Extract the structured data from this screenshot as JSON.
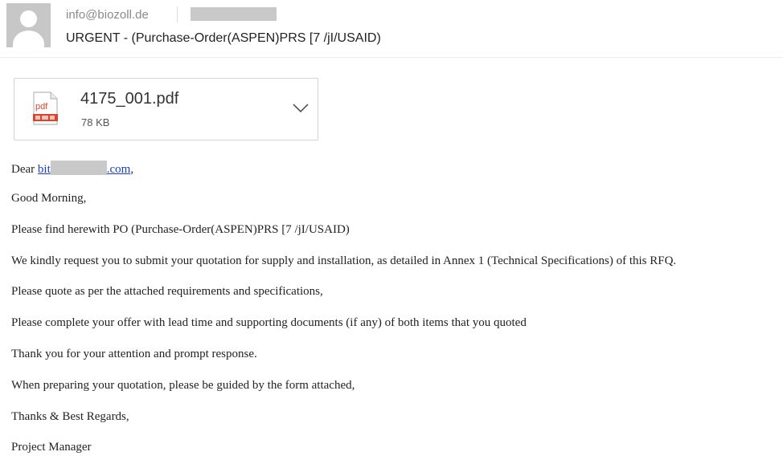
{
  "header": {
    "sender": "info@biozoll.de",
    "subject": "URGENT - (Purchase-Order(ASPEN)PRS [7 /jI/USAID)"
  },
  "attachment": {
    "name": "4175_001.pdf",
    "size": "78 KB",
    "icon_text": "pdf"
  },
  "body": {
    "greeting_prefix": "Dear",
    "recipient_start": "bit",
    "recipient_end": ".com",
    "greeting_suffix": ",",
    "lines": [
      "Good Morning,",
      "Please find herewith PO (Purchase-Order(ASPEN)PRS [7 /jI/USAID)",
      "We kindly request you to submit your quotation for supply and installation, as detailed in Annex 1 (Technical Specifications) of this RFQ.",
      "Please quote as per the attached requirements and specifications,",
      "Please complete your offer with lead time and supporting documents (if any) of both items that you quoted",
      "Thank you for your attention and prompt response.",
      "When preparing your quotation, please be guided by the form attached,",
      "Thanks & Best Regards,",
      "Project Manager"
    ]
  },
  "colors": {
    "link": "#1a3ccf",
    "redaction": "#c9c9c9",
    "pdf_red": "#d9452b"
  }
}
